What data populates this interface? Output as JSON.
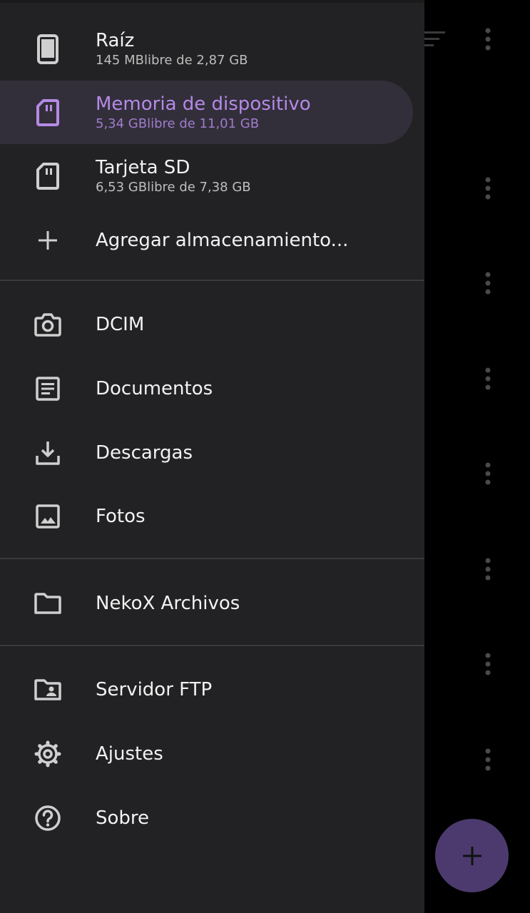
{
  "storage": [
    {
      "title": "Raíz",
      "subtitle": "145 MBlibre de 2,87 GB",
      "icon": "phone-icon"
    },
    {
      "title": "Memoria de dispositivo",
      "subtitle": "5,34 GBlibre de 11,01 GB",
      "icon": "sd-card-icon",
      "selected": true
    },
    {
      "title": "Tarjeta SD",
      "subtitle": "6,53 GBlibre de 7,38 GB",
      "icon": "sd-card-icon"
    },
    {
      "title": "Agregar almacenamiento...",
      "icon": "plus-icon"
    }
  ],
  "folders": [
    {
      "title": "DCIM",
      "icon": "camera-icon"
    },
    {
      "title": "Documentos",
      "icon": "document-icon"
    },
    {
      "title": "Descargas",
      "icon": "download-icon"
    },
    {
      "title": "Fotos",
      "icon": "image-icon"
    }
  ],
  "app_folder": {
    "title": "NekoX Archivos",
    "icon": "folder-icon"
  },
  "actions": [
    {
      "title": "Servidor FTP",
      "icon": "folder-shared-icon"
    },
    {
      "title": "Ajustes",
      "icon": "gear-icon"
    },
    {
      "title": "Sobre",
      "icon": "help-icon"
    }
  ],
  "colors": {
    "drawer_bg": "#222224",
    "accent": "#b58ae6",
    "selected_bg": "#322f3a",
    "fab": "#4c3a6e"
  }
}
